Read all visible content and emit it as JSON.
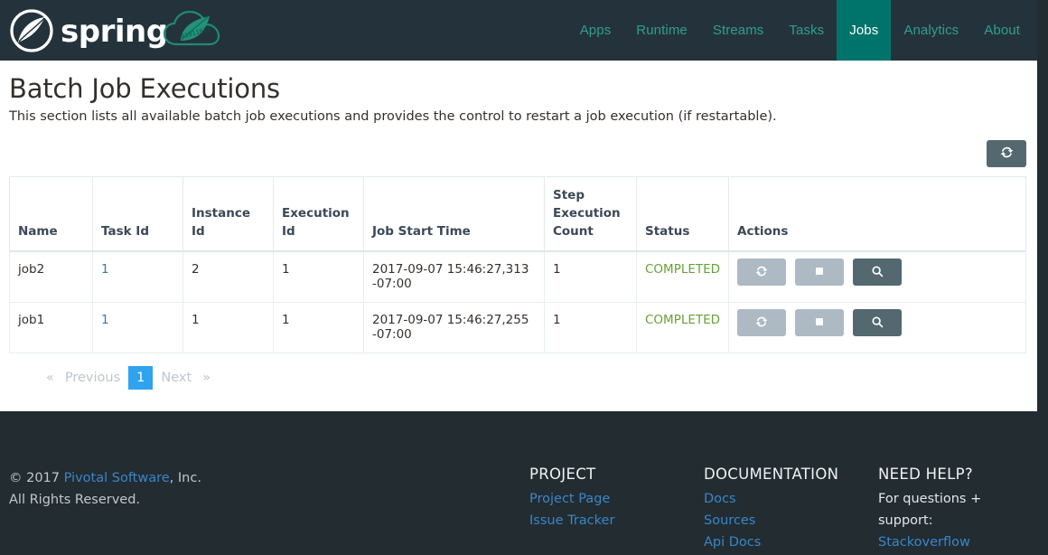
{
  "brand": {
    "name": "spring",
    "logo_icon": "spring-leaf-logo",
    "cloud_icon": "spring-cloud-dataflow-icon"
  },
  "nav": {
    "items": [
      {
        "label": "Apps",
        "active": false
      },
      {
        "label": "Runtime",
        "active": false
      },
      {
        "label": "Streams",
        "active": false
      },
      {
        "label": "Tasks",
        "active": false
      },
      {
        "label": "Jobs",
        "active": true
      },
      {
        "label": "Analytics",
        "active": false
      },
      {
        "label": "About",
        "active": false
      }
    ],
    "active_bg": "#00736b",
    "link_color": "#2f9e8f"
  },
  "page": {
    "title": "Batch Job Executions",
    "description": "This section lists all available batch job executions and provides the control to restart a job execution (if restartable)."
  },
  "toolbar": {
    "refresh_label": "",
    "refresh_icon": "refresh-icon"
  },
  "table": {
    "columns": [
      "Name",
      "Task Id",
      "Instance Id",
      "Execution Id",
      "Job Start Time",
      "Step Execution Count",
      "Status",
      "Actions"
    ],
    "rows": [
      {
        "name": "job2",
        "task_id": "1",
        "instance_id": "2",
        "execution_id": "1",
        "job_start_time": "2017-09-07 15:46:27,313 -07:00",
        "step_execution_count": "1",
        "status": "COMPLETED",
        "actions": [
          {
            "icon": "restart-icon",
            "state": "disabled"
          },
          {
            "icon": "stop-icon",
            "state": "disabled"
          },
          {
            "icon": "search-icon",
            "state": "enabled"
          }
        ]
      },
      {
        "name": "job1",
        "task_id": "1",
        "instance_id": "1",
        "execution_id": "1",
        "job_start_time": "2017-09-07 15:46:27,255 -07:00",
        "step_execution_count": "1",
        "status": "COMPLETED",
        "actions": [
          {
            "icon": "restart-icon",
            "state": "disabled"
          },
          {
            "icon": "stop-icon",
            "state": "disabled"
          },
          {
            "icon": "search-icon",
            "state": "enabled"
          }
        ]
      }
    ],
    "status_color": "#69a038",
    "link_color": "#3778b0"
  },
  "pagination": {
    "prev_chevron": "«",
    "prev_label": "Previous",
    "pages": [
      "1"
    ],
    "current_page": "1",
    "next_label": "Next",
    "next_chevron": "»",
    "active_bg": "#2fa3f0"
  },
  "footer": {
    "copyright_prefix": "© 2017 ",
    "company_link": "Pivotal Software",
    "copyright_suffix": ", Inc.",
    "rights": "All Rights Reserved.",
    "columns": [
      {
        "heading": "PROJECT",
        "links": [
          "Project Page",
          "Issue Tracker"
        ],
        "text": ""
      },
      {
        "heading": "DOCUMENTATION",
        "links": [
          "Docs",
          "Sources",
          "Api Docs"
        ],
        "text": ""
      },
      {
        "heading": "NEED HELP?",
        "links": [
          "Stackoverflow"
        ],
        "text": "For questions + support:"
      }
    ],
    "link_color": "#3a86c8"
  }
}
